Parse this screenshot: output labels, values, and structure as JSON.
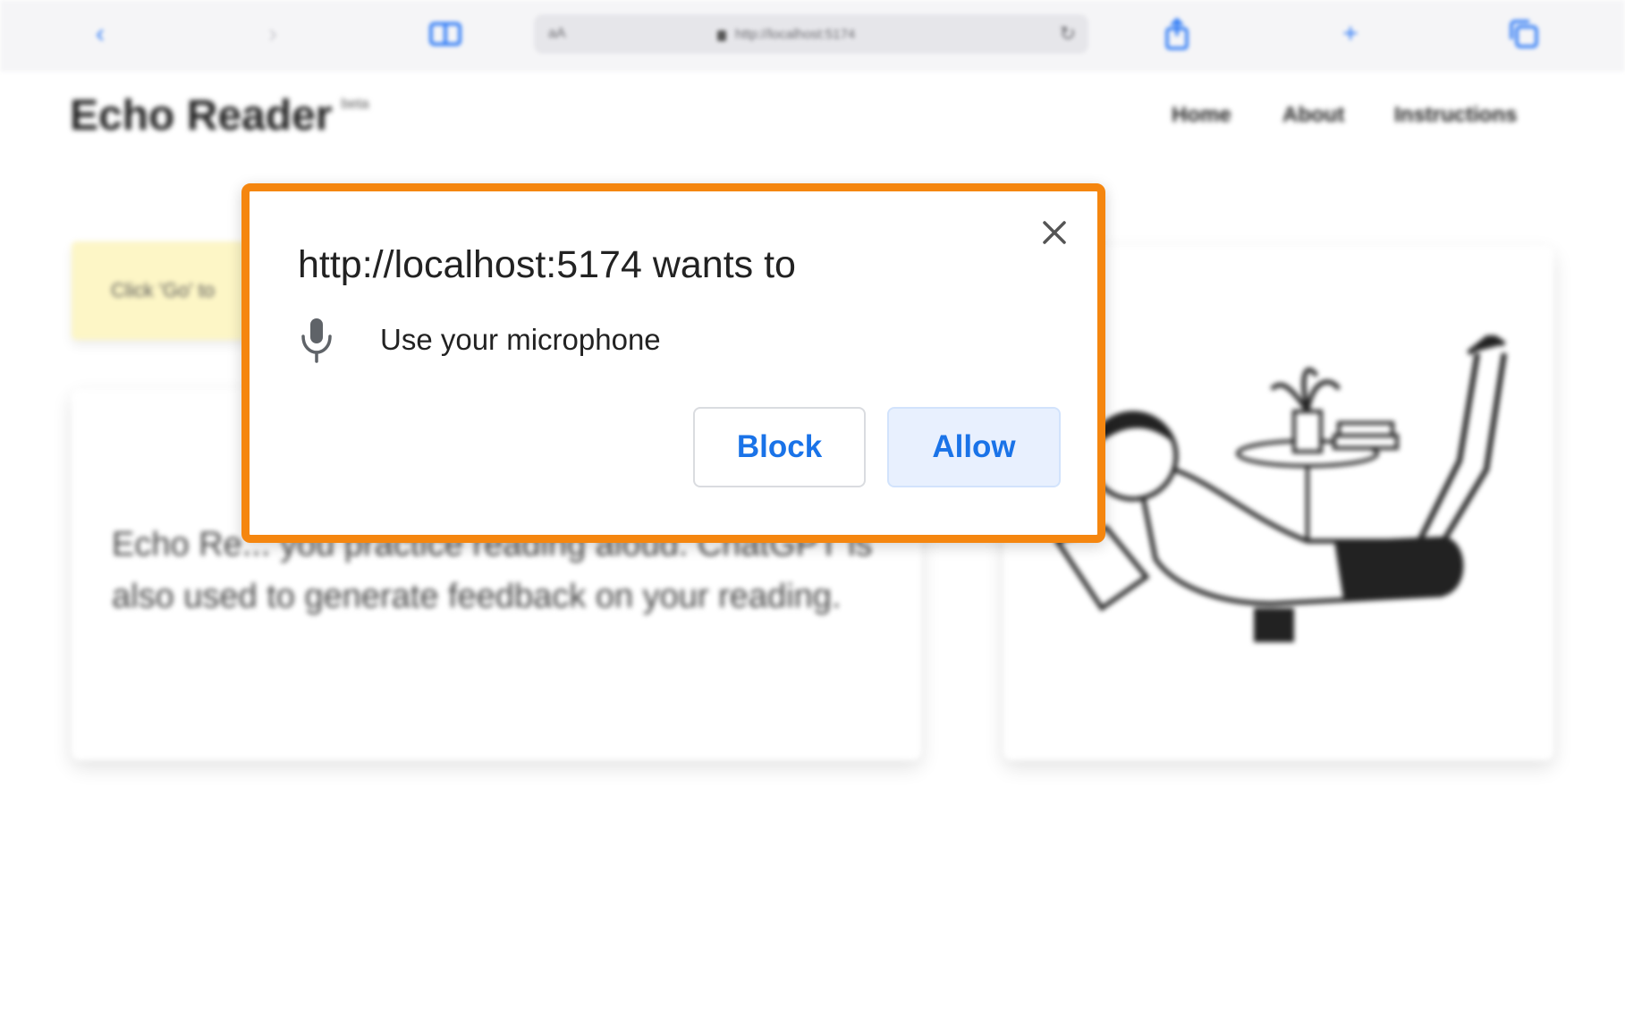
{
  "browser": {
    "address_prefix": "aA",
    "url": "http://localhost:5174",
    "icons": [
      "back-icon",
      "forward-icon",
      "reader-icon",
      "lock-icon",
      "reload-icon",
      "share-icon",
      "new-tab-icon",
      "tabs-icon"
    ]
  },
  "page": {
    "brand": "Echo Reader",
    "brand_badge": "beta",
    "nav": [
      "Home",
      "About",
      "Instructions"
    ],
    "note": "Click 'Go' to",
    "intro": "Echo Re... you practice reading aloud. ChatGPT is also used to generate feedback on your reading."
  },
  "dialog": {
    "title": "http://localhost:5174 wants to",
    "permission": "Use your microphone",
    "permission_icon": "microphone-icon",
    "block_label": "Block",
    "allow_label": "Allow",
    "close_icon": "close-icon",
    "highlight_color": "#f5860f",
    "button_text_color": "#1a73e8"
  }
}
